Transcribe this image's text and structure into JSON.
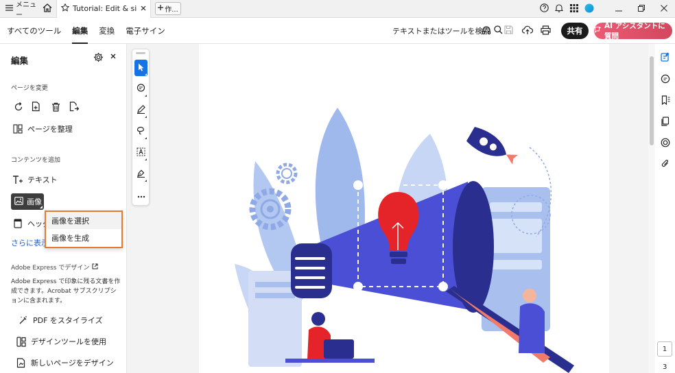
{
  "titlebar": {
    "menu_label": "メニュー",
    "tab_title": "Tutorial: Edit & sign ...",
    "new_tab_label": "作..."
  },
  "toolbar": {
    "nav": [
      "すべてのツール",
      "編集",
      "変換",
      "電子サイン"
    ],
    "active_nav": "編集",
    "search_label": "テキストまたはツールを検索",
    "share_label": "共有",
    "ai_label": "AI アシスタントに質問",
    "accent": "#1473e6",
    "ai_color": "#e0566a"
  },
  "left_panel": {
    "title": "編集",
    "section_page": "ページを変更",
    "organize_label": "ページを整理",
    "section_content": "コンテンツを追加",
    "text_label": "テキスト",
    "image_label": "画像",
    "header_label": "ヘッダ",
    "more_label": "さらに表示",
    "express_title": "Adobe Express でデザイン",
    "express_desc": "Adobe Express で印象に残る文書を作成できます。Acrobat サブスクリプションに含まれます。",
    "stylize_label": "PDF をスタイライズ",
    "design_tools_label": "デザインツールを使用",
    "new_page_label": "新しいページをデザイン"
  },
  "dropdown": {
    "items": [
      "画像を選択",
      "画像を生成"
    ],
    "border_color": "#e47b2c"
  },
  "pager": {
    "current": "1",
    "total": "3"
  }
}
